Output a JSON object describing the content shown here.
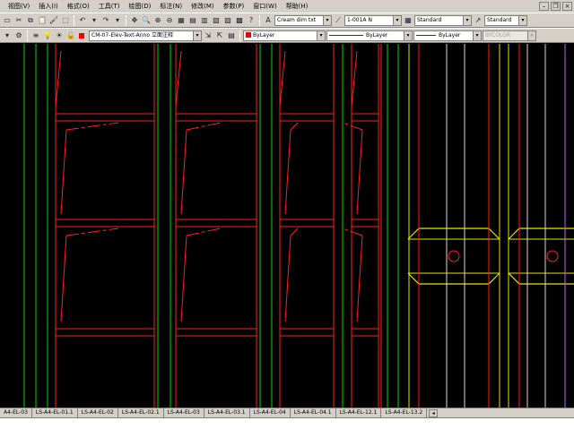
{
  "menu": {
    "items": [
      "视图(V)",
      "插入(I)",
      "格式(O)",
      "工具(T)",
      "绘图(D)",
      "标注(N)",
      "修改(M)",
      "参数(P)",
      "窗口(W)",
      "帮助(H)"
    ]
  },
  "toolbar1": {
    "text_style": "Cream dim txt",
    "dim_style": "1-001A N",
    "table_style": "Standard",
    "multileader_style": "Standard"
  },
  "toolbar2": {
    "layer": "CM-07-Elev-Text-Anno 立面注释",
    "color": "ByLayer",
    "linetype": "ByLayer",
    "lineweight": "ByLayer",
    "plot_style": "BYCOLOR"
  },
  "layout_tabs": [
    "A4-EL-03",
    "LS-A4-EL-01.1",
    "LS-A4-EL-02",
    "LS-A4-EL-02.1",
    "LS-A4-EL-03",
    "LS-A4-EL-03.1",
    "LS-A4-EL-04",
    "LS-A4-EL-04.1",
    "LS-A4-EL-12.1",
    "LS-A4-EL-13.2"
  ],
  "drawing_colors": {
    "background": "#000000",
    "red": "#ff2020",
    "green": "#00dd00",
    "yellow": "#e6e600",
    "white": "#d8d8d8",
    "magenta": "#c060ff"
  }
}
